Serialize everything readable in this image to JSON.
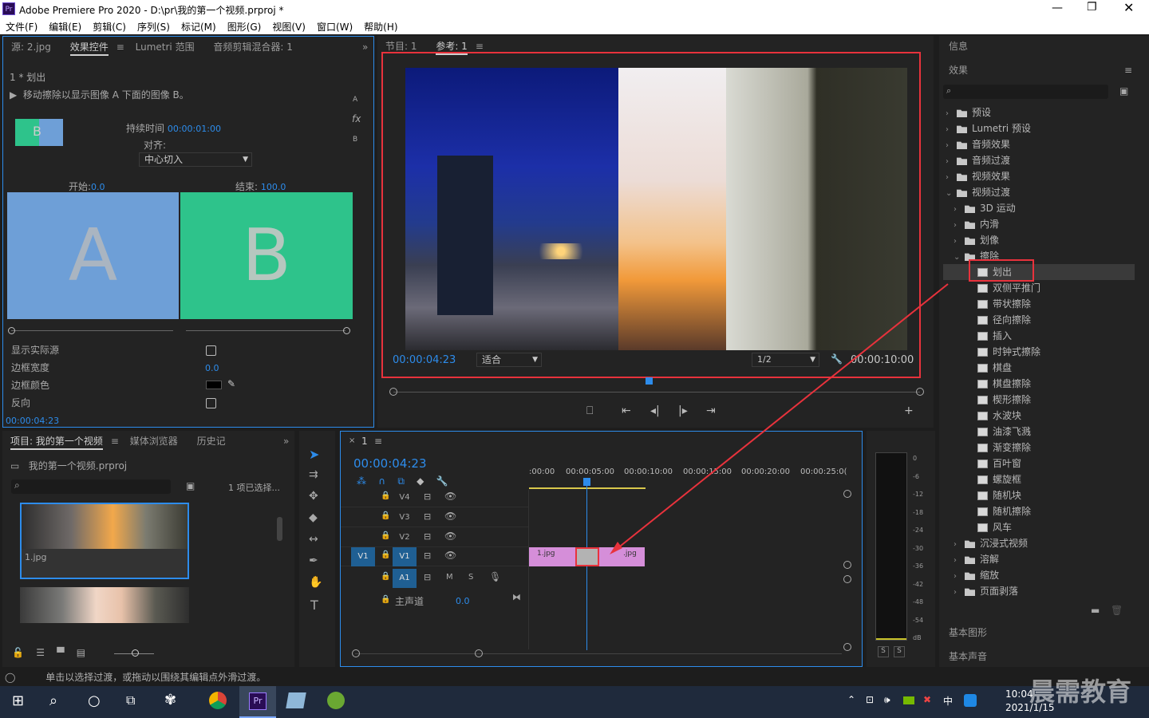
{
  "window": {
    "title": "Adobe Premiere Pro 2020 - D:\\pr\\我的第一个视频.prproj *",
    "app_icon": "Pr"
  },
  "menu": [
    "文件(F)",
    "编辑(E)",
    "剪辑(C)",
    "序列(S)",
    "标记(M)",
    "图形(G)",
    "视图(V)",
    "窗口(W)",
    "帮助(H)"
  ],
  "source_panel": {
    "tabs": [
      "源: 2.jpg",
      "效果控件",
      "Lumetri 范围",
      "音频剪辑混合器: 1"
    ],
    "breadcrumb": "1 * 划出",
    "description": "移动擦除以显示图像 A 下面的图像 B。",
    "duration_label": "持续时间",
    "duration": "00:00:01:00",
    "align_label": "对齐:",
    "align_value": "中心切入",
    "start_label": "开始:",
    "start_value": "0.0",
    "end_label": "结束:",
    "end_value": "100.0",
    "letter_a": "A",
    "letter_b": "B",
    "show_actual": "显示实际源",
    "border_width_label": "边框宽度",
    "border_width": "0.0",
    "border_color_label": "边框颜色",
    "reverse_label": "反向",
    "timecode": "00:00:04:23",
    "side_a": "A",
    "side_b": "B",
    "fx": "fx"
  },
  "program_panel": {
    "tabs": [
      "节目: 1",
      "参考: 1"
    ],
    "timecode": "00:00:04:23",
    "fit": "适合",
    "resolution": "1/2",
    "duration": "00:00:10:00"
  },
  "project_panel": {
    "tabs": [
      "项目: 我的第一个视频",
      "媒体浏览器",
      "历史记"
    ],
    "file": "我的第一个视频.prproj",
    "selected": "1 项已选择...",
    "item1": "1.jpg"
  },
  "timeline": {
    "tab": "1",
    "timecode": "00:00:04:23",
    "ruler": [
      ":00:00",
      "00:00:05:00",
      "00:00:10:00",
      "00:00:15:00",
      "00:00:20:00",
      "00:00:25:0("
    ],
    "tracks": [
      "V4",
      "V3",
      "V2",
      "V1",
      "A1"
    ],
    "src_v1": "V1",
    "master": "主声道",
    "master_val": "0.0",
    "clip1": "1.jpg",
    "clip2": ".jpg",
    "m": "M",
    "s": "S"
  },
  "meter": {
    "labels": [
      "0",
      "-6",
      "-12",
      "-18",
      "-24",
      "-30",
      "-36",
      "-42",
      "-48",
      "-54",
      "dB"
    ],
    "solo": [
      "S",
      "S"
    ]
  },
  "effects_panel": {
    "info": "信息",
    "title": "效果",
    "folders": [
      "预设",
      "Lumetri 预设",
      "音频效果",
      "音频过渡",
      "视频效果",
      "视频过渡"
    ],
    "sub": [
      "3D 运动",
      "内滑",
      "划像",
      "擦除"
    ],
    "transitions": [
      "划出",
      "双侧平推门",
      "带状擦除",
      "径向擦除",
      "插入",
      "时钟式擦除",
      "棋盘",
      "棋盘擦除",
      "楔形擦除",
      "水波块",
      "油漆飞溅",
      "渐变擦除",
      "百叶窗",
      "螺旋框",
      "随机块",
      "随机擦除",
      "风车"
    ],
    "sub2": [
      "沉浸式视频",
      "溶解",
      "缩放",
      "页面剥落"
    ],
    "basic_graphics": "基本图形",
    "basic_sound": "基本声音"
  },
  "status": "单击以选择过渡，或拖动以围绕其编辑点外滑过渡。",
  "taskbar": {
    "time": "10:04",
    "date": "2021/1/15",
    "ime": "中",
    "watermark": "晨需教育"
  },
  "colors": {
    "accent": "#2d8ceb",
    "highlight": "#e8323c",
    "clip": "#d58ed9",
    "green": "#2ec38b",
    "blue_a": "#6e9fd7"
  }
}
